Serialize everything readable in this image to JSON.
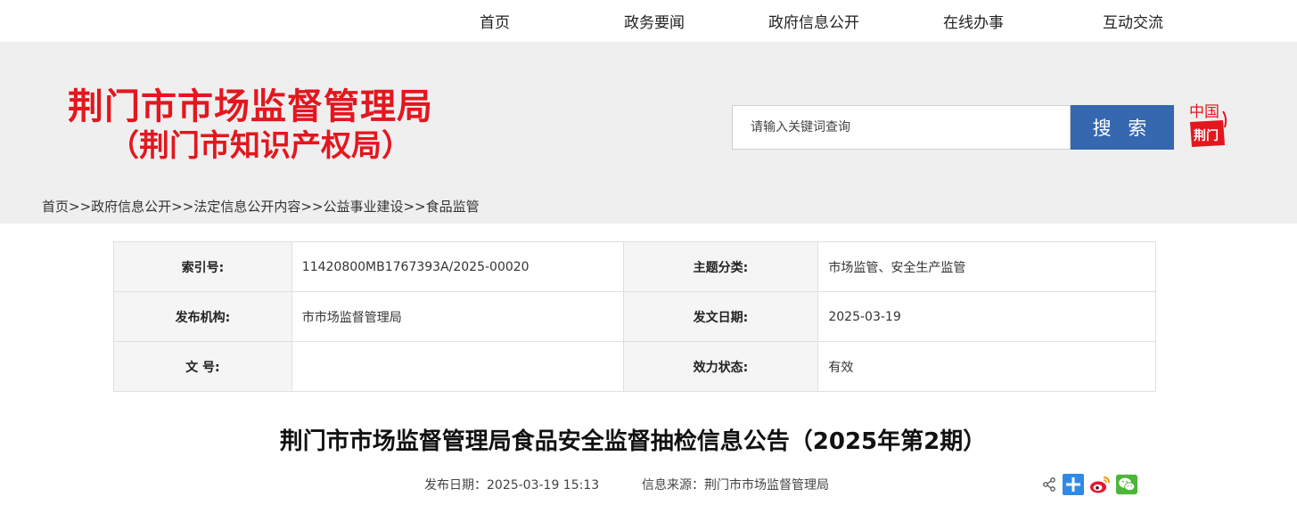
{
  "nav": {
    "items": [
      {
        "label": "首页"
      },
      {
        "label": "政务要闻"
      },
      {
        "label": "政府信息公开"
      },
      {
        "label": "在线办事"
      },
      {
        "label": "互动交流"
      }
    ]
  },
  "header": {
    "site_name": "荆门市市场监督管理局",
    "site_subname": "（荆门市知识产权局）",
    "seal_text_top": "中国",
    "seal_text_bottom": "荆门"
  },
  "search": {
    "placeholder": "请输入关键词查询",
    "button_label": "搜 索"
  },
  "breadcrumb": {
    "items": [
      "首页",
      "政府信息公开",
      "法定信息公开内容",
      "公益事业建设",
      "食品监管"
    ],
    "separator": ">>"
  },
  "meta": {
    "index_label": "索引号:",
    "index_value": "11420800MB1767393A/2025-00020",
    "topic_label": "主题分类:",
    "topic_value": "市场监管、安全生产监管",
    "org_label": "发布机构:",
    "org_value": "市市场监督管理局",
    "date_label": "发文日期:",
    "date_value": "2025-03-19",
    "docno_label": "文 号:",
    "docno_value": "",
    "status_label": "效力状态:",
    "status_value": "有效"
  },
  "article": {
    "title": "荆门市市场监督管理局食品安全监督抽检信息公告（2025年第2期）",
    "publish_date": "发布日期：2025-03-19 15:13",
    "source": "信息来源：荆门市市场监督管理局"
  },
  "share": {
    "icons": [
      "share-icon",
      "plus-icon",
      "weibo-icon",
      "wechat-icon"
    ]
  },
  "colors": {
    "brand_red": "#e4161e",
    "search_blue": "#3568ae",
    "banner_bg": "#efefef"
  }
}
